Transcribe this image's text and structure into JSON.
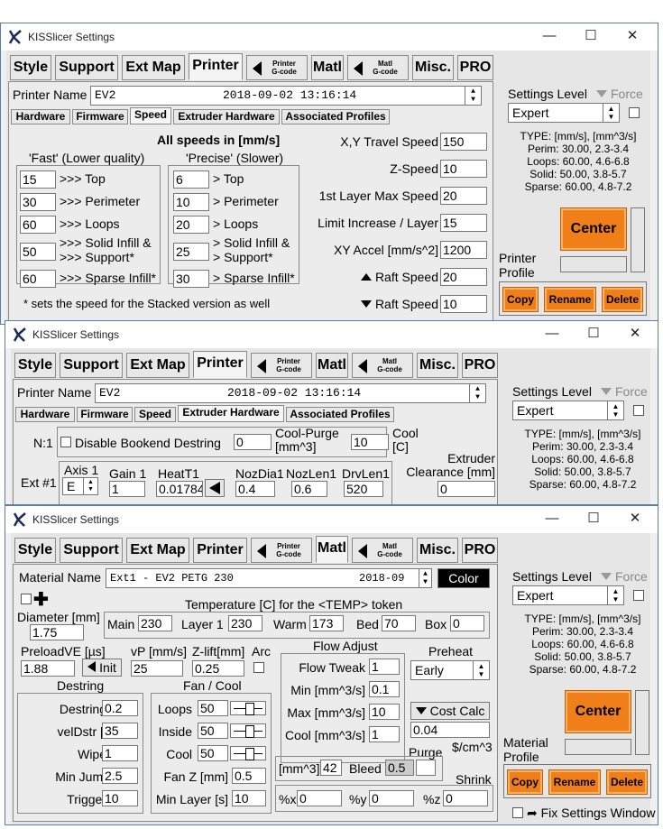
{
  "app": {
    "title": "KISSlicer Settings"
  },
  "window_controls": {
    "minimize": "—",
    "maximize": "☐",
    "close": "✕"
  },
  "tabs": [
    "Style",
    "Support",
    "Ext Map",
    "Printer",
    "Matl",
    "Misc.",
    "PRO"
  ],
  "gcode_tabs": {
    "printer": [
      "Printer",
      "G-code"
    ],
    "matl": [
      "Matl",
      "G-code"
    ]
  },
  "sidebar": {
    "settings_level_label": "Settings Level",
    "force_label": "Force",
    "level_value": "Expert",
    "type_lines": [
      "TYPE: [mm/s], [mm^3/s]",
      "Perim:  30.00,  2.3-3.4",
      "Loops:  60.00,  4.6-6.8",
      "Solid:  50.00,  3.8-5.7",
      "Sparse:  60.00,  4.8-7.2"
    ],
    "center_label": "Center",
    "copy_label": "Copy",
    "rename_label": "Rename",
    "delete_label": "Delete",
    "printer_profile": [
      "Printer",
      "Profile"
    ],
    "material_profile": [
      "Material",
      "Profile"
    ],
    "fix_window_label": "Fix Settings Window"
  },
  "printer": {
    "name_label": "Printer Name",
    "name_value": "EV2",
    "name_date": "2018-09-02 13:16:14",
    "subtabs": [
      "Hardware",
      "Firmware",
      "Speed",
      "Extruder Hardware",
      "Associated Profiles"
    ]
  },
  "speed": {
    "header": "All speeds in [mm/s]",
    "fast_label": "'Fast' (Lower quality)",
    "precise_label": "'Precise' (Slower)",
    "fast": [
      {
        "value": "15",
        "label": ">>> Top"
      },
      {
        "value": "30",
        "label": ">>> Perimeter"
      },
      {
        "value": "60",
        "label": ">>> Loops"
      },
      {
        "value": "50",
        "label1": ">>> Solid Infill &",
        "label2": ">>> Support*"
      },
      {
        "value": "60",
        "label": ">>> Sparse Infill*"
      }
    ],
    "precise": [
      {
        "value": "6",
        "label": "> Top"
      },
      {
        "value": "10",
        "label": "> Perimeter"
      },
      {
        "value": "20",
        "label": "> Loops"
      },
      {
        "value": "25",
        "label1": "> Solid Infill &",
        "label2": "> Support*"
      },
      {
        "value": "30",
        "label": "> Sparse Infill*"
      }
    ],
    "right": [
      {
        "label": "X,Y Travel Speed",
        "value": "150"
      },
      {
        "label": "Z-Speed",
        "value": "10"
      },
      {
        "label": "1st Layer Max Speed",
        "value": "20"
      },
      {
        "label": "Limit Increase / Layer",
        "value": "15"
      },
      {
        "label": "XY Accel [mm/s^2]",
        "value": "1200"
      },
      {
        "label": "Raft Speed",
        "value": "20"
      },
      {
        "label": "Raft Speed",
        "value": "10"
      }
    ],
    "footnote": "* sets the speed for the Stacked version as well"
  },
  "extruder": {
    "n1_label": "N:1",
    "bookend_label": "Disable Bookend Destring",
    "bookend_value": "0",
    "cool_purge_label": [
      "Cool-Purge",
      "[mm^3]"
    ],
    "cool_purge_value": "10",
    "cool_c_label": [
      "Cool",
      "[C]"
    ],
    "ext_label": "Ext #1",
    "axis_label": "Axis 1",
    "axis_value": "E",
    "gain_label": "Gain 1",
    "gain_value": "1",
    "heat_label": "HeatT1",
    "heat_value": "0.01784",
    "noz_dia_label": "NozDia1",
    "noz_dia_value": "0.4",
    "noz_len_label": "NozLen1",
    "noz_len_value": "0.6",
    "drv_len_label": "DrvLen1",
    "drv_len_value": "520",
    "clearance_label": [
      "Extruder",
      "Clearance [mm]"
    ],
    "clearance_value": "0"
  },
  "material": {
    "name_label": "Material Name",
    "name_value": "Ext1 - EV2 PETG 230",
    "name_date": "2018-09",
    "color_label": "Color",
    "diameter_label": "Diameter [mm]",
    "diameter_value": "1.75",
    "temp_header": "Temperature [C] for the <TEMP> token",
    "temps": [
      {
        "label": "Main",
        "value": "230"
      },
      {
        "label": "Layer 1",
        "value": "230"
      },
      {
        "label": "Warm",
        "value": "173"
      },
      {
        "label": "Bed",
        "value": "70"
      },
      {
        "label": "Box",
        "value": "0"
      }
    ],
    "preload_label": "PreloadVE [µs]",
    "preload_value": "1.88",
    "init_label": "Init",
    "vp_label": "vP [mm/s]",
    "vp_value": "25",
    "zlift_label": "Z-lift[mm]",
    "zlift_value": "0.25",
    "arc_label": "Arc",
    "destring_header": "Destring",
    "destring": [
      {
        "label": "Destring [mm]",
        "value": "0.2"
      },
      {
        "label": "velDstr [mm/s]",
        "value": "35"
      },
      {
        "label": "Wipe [mm]",
        "value": "1"
      },
      {
        "label": "Min Jump[mm]",
        "value": "2.5"
      },
      {
        "label": "Trigger [mm]",
        "value": "10"
      }
    ],
    "fan_header": "Fan / Cool",
    "fans": [
      {
        "label": "Loops",
        "value": "50"
      },
      {
        "label": "Inside",
        "value": "50"
      },
      {
        "label": "Cool",
        "value": "50"
      }
    ],
    "fan_z_label": "Fan Z [mm]",
    "fan_z_value": "0.5",
    "min_layer_label": "Min Layer [s]",
    "min_layer_value": "10",
    "flow_header": "Flow Adjust",
    "flow": [
      {
        "label": "Flow Tweak",
        "value": "1"
      },
      {
        "label": "Min [mm^3/s]",
        "value": "0.1"
      },
      {
        "label": "Max [mm^3/s]",
        "value": "10"
      },
      {
        "label": "Cool [mm^3/s]",
        "value": "1"
      }
    ],
    "preheat_label": "Preheat",
    "preheat_value": "Early",
    "cost_label": "Cost Calc",
    "cost_value": "0.04",
    "cost_unit": "$/cm^3",
    "purge_label": "Purge",
    "purge_mm3_label": "[mm^3]",
    "purge_mm3_value": "42",
    "bleed_label": "Bleed",
    "bleed_value": "0.5",
    "shrink_label": "Shrink",
    "shrink": [
      {
        "label": "%x",
        "value": "0"
      },
      {
        "label": "%y",
        "value": "0"
      },
      {
        "label": "%z",
        "value": "0"
      }
    ]
  }
}
